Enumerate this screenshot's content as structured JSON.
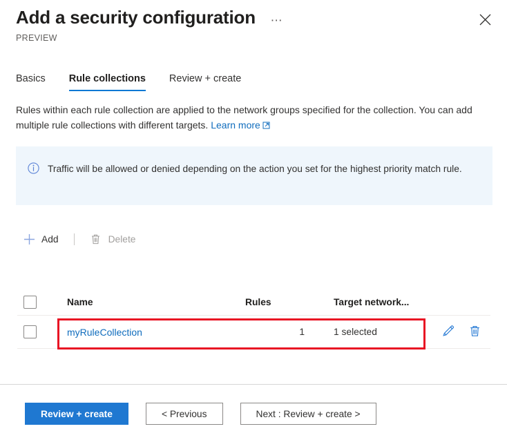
{
  "header": {
    "title": "Add a security configuration",
    "preview_label": "PREVIEW",
    "more_icon": "ellipsis-icon",
    "close_icon": "close-icon"
  },
  "tabs": [
    {
      "label": "Basics",
      "active": false
    },
    {
      "label": "Rule collections",
      "active": true
    },
    {
      "label": "Review + create",
      "active": false
    }
  ],
  "description": {
    "text": "Rules within each rule collection are applied to the network groups specified for the collection. You can add multiple rule collections with different targets.",
    "link_label": "Learn more",
    "link_icon": "external-link-icon"
  },
  "info_banner": {
    "icon": "info-circle-icon",
    "text": "Traffic will be allowed or denied depending on the action you set for the highest priority match rule.",
    "background": "#eff6fc"
  },
  "command_bar": {
    "add_label": "Add",
    "add_icon": "plus-icon",
    "delete_label": "Delete",
    "delete_icon": "trash-icon",
    "delete_disabled": true
  },
  "table": {
    "columns": [
      "Name",
      "Rules",
      "Target network..."
    ],
    "rows": [
      {
        "name": "myRuleCollection",
        "rules": "1",
        "target": "1 selected",
        "edit_icon": "pencil-icon",
        "delete_icon": "trash-icon",
        "highlighted": true
      }
    ]
  },
  "footer": {
    "primary_label": "Review + create",
    "previous_label": "< Previous",
    "next_label": "Next : Review + create >"
  },
  "colors": {
    "accent": "#0078d4",
    "link": "#0f6cbd",
    "primary_button": "#1f78d1",
    "highlight": "#e81123",
    "info_background": "#eff6fc"
  }
}
